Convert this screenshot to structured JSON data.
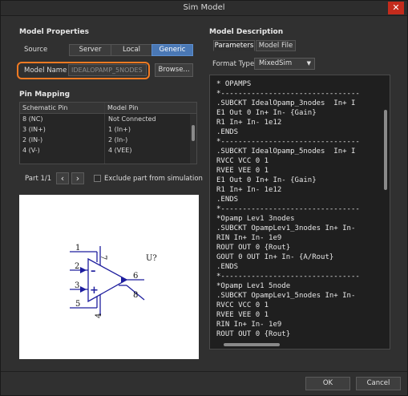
{
  "window": {
    "title": "Sim Model",
    "close_glyph": "✕"
  },
  "model_properties": {
    "heading": "Model Properties",
    "source_label": "Source",
    "source_options": [
      "Server",
      "Local",
      "Generic"
    ],
    "selected_source": "Generic",
    "model_name_label": "Model Name",
    "model_name_value": "IDEALOPAMP_5NODES",
    "browse_label": "Browse..."
  },
  "pin_mapping": {
    "heading": "Pin Mapping",
    "columns": [
      "Schematic Pin",
      "Model Pin"
    ],
    "rows": [
      [
        "8 (NC)",
        "Not Connected"
      ],
      [
        "3 (IN+)",
        "1 (In+)"
      ],
      [
        "2 (IN-)",
        "2 (In-)"
      ],
      [
        "4 (V-)",
        "4 (VEE)"
      ],
      [
        "",
        ""
      ]
    ],
    "part_label": "Part 1/1",
    "prev_glyph": "‹",
    "next_glyph": "›",
    "exclude_label": "Exclude part from simulation"
  },
  "symbol": {
    "designator": "U?",
    "pins": [
      "1",
      "2",
      "3",
      "5",
      "6",
      "7",
      "8",
      "4"
    ],
    "minus_sign": "–",
    "plus_sign": "+"
  },
  "model_description": {
    "heading": "Model Description",
    "tabs": [
      "Parameters",
      "Model File"
    ],
    "active_tab": "Parameters",
    "format_type_label": "Format Type",
    "format_type_value": "MixedSim",
    "code_lines": [
      "* OPAMPS",
      "*--------------------------------",
      ".SUBCKT IdealOpamp_3nodes  In+ I",
      "E1 Out 0 In+ In- {Gain}",
      "R1 In+ In- 1e12",
      ".ENDS",
      "*--------------------------------",
      ".SUBCKT IdealOpamp_5nodes  In+ I",
      "RVCC VCC 0 1",
      "RVEE VEE 0 1",
      "E1 Out 0 In+ In- {Gain}",
      "R1 In+ In- 1e12",
      ".ENDS",
      "*--------------------------------",
      "*Opamp Lev1 3nodes",
      ".SUBCKT OpampLev1_3nodes In+ In-",
      "RIN In+ In- 1e9",
      "ROUT OUT 0 {Rout}",
      "GOUT 0 OUT In+ In- {A/Rout}",
      ".ENDS",
      "*--------------------------------",
      "*Opamp Lev1 5node",
      ".SUBCKT OpampLev1_5nodes In+ In-",
      "RVCC VCC 0 1",
      "RVEE VEE 0 1",
      "RIN In+ In- 1e9",
      "ROUT OUT 0 {Rout}"
    ]
  },
  "footer": {
    "ok_label": "OK",
    "cancel_label": "Cancel"
  },
  "colors": {
    "accent": "#4a78b5",
    "highlight": "#f07a22"
  }
}
